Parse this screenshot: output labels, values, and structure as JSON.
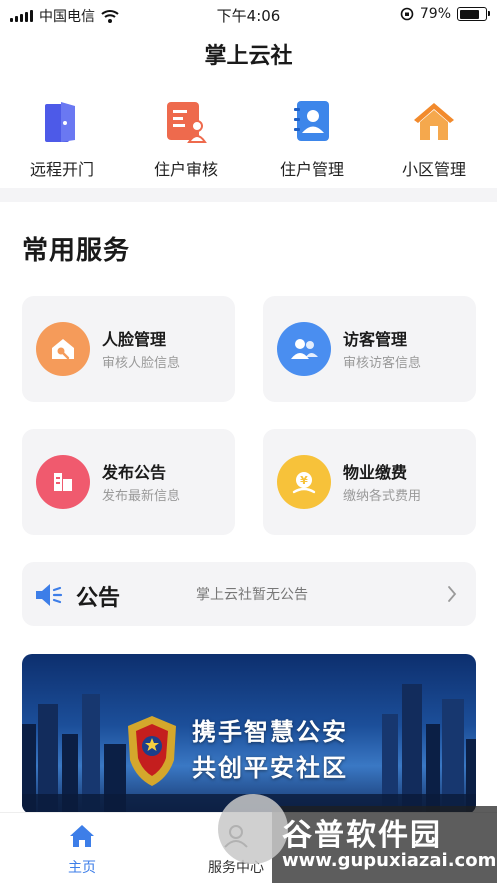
{
  "status_bar": {
    "carrier": "中国电信",
    "time": "下午4:06",
    "battery": "79%",
    "battery_level": 0.79
  },
  "header": {
    "title": "掌上云社"
  },
  "quick_actions": [
    {
      "label": "远程开门",
      "icon": "door-icon",
      "color": "#4d5ae8"
    },
    {
      "label": "住户审核",
      "icon": "resident-review-icon",
      "color": "#ee6a4d"
    },
    {
      "label": "住户管理",
      "icon": "contact-book-icon",
      "color": "#3d86ea"
    },
    {
      "label": "小区管理",
      "icon": "house-icon",
      "color": "#f59b3b"
    }
  ],
  "services": {
    "title": "常用服务",
    "items": [
      {
        "title": "人脸管理",
        "subtitle": "审核人脸信息",
        "icon": "face-icon",
        "color": "#f59b5a"
      },
      {
        "title": "访客管理",
        "subtitle": "审核访客信息",
        "icon": "visitor-icon",
        "color": "#4a8ef0"
      },
      {
        "title": "发布公告",
        "subtitle": "发布最新信息",
        "icon": "announcement-icon",
        "color": "#f05a6e"
      },
      {
        "title": "物业缴费",
        "subtitle": "缴纳各式费用",
        "icon": "payment-icon",
        "color": "#f7c23a"
      }
    ]
  },
  "notice": {
    "label": "公告",
    "text": "掌上云社暂无公告",
    "icon": "speaker-icon",
    "color": "#3d7ee8"
  },
  "banner": {
    "line1": "携手智慧公安",
    "line2": "共创平安社区"
  },
  "tabbar": {
    "items": [
      {
        "label": "主页",
        "icon": "home-icon",
        "active": true,
        "color": "#3d7ee8"
      },
      {
        "label": "服务中心",
        "icon": "service-icon",
        "active": false,
        "color": "#333333"
      }
    ]
  },
  "watermark": {
    "name": "谷普软件园",
    "url": "www.gupuxiazai.com"
  }
}
